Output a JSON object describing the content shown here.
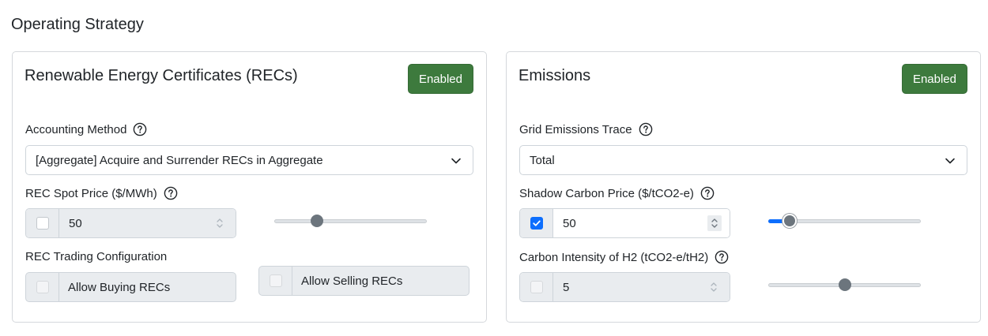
{
  "section_title": "Operating Strategy",
  "recs": {
    "title": "Renewable Energy Certificates (RECs)",
    "enabled_label": "Enabled",
    "accounting_method_label": "Accounting Method",
    "accounting_method_value": "[Aggregate] Acquire and Surrender RECs in Aggregate",
    "spot_price_label": "REC Spot Price ($/MWh)",
    "spot_price_value": "50",
    "spot_price_checked": false,
    "spot_price_slider_fraction": 0.28,
    "trading_label": "REC Trading Configuration",
    "allow_buying_label": "Allow Buying RECs",
    "allow_selling_label": "Allow Selling RECs"
  },
  "emissions": {
    "title": "Emissions",
    "enabled_label": "Enabled",
    "grid_trace_label": "Grid Emissions Trace",
    "grid_trace_value": "Total",
    "shadow_price_label": "Shadow Carbon Price ($/tCO2-e)",
    "shadow_price_value": "50",
    "shadow_price_checked": true,
    "shadow_price_slider_fraction": 0.14,
    "carbon_intensity_label": "Carbon Intensity of H2 (tCO2-e/tH2)",
    "carbon_intensity_value": "5",
    "carbon_intensity_checked": false,
    "carbon_intensity_slider_fraction": 0.5
  },
  "colors": {
    "enabled_button": "#3d7a3d",
    "checked_accent": "#0d6efd",
    "disabled_field": "#e9ecef"
  },
  "icons": {
    "help": "question-circle-icon",
    "dropdown": "chevron-down-icon",
    "spinner": "up-down-spinner-icon",
    "check": "check-icon"
  }
}
